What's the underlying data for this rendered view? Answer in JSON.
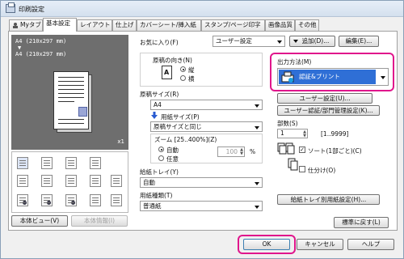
{
  "window": {
    "title": "印刷設定"
  },
  "tabs": [
    "Myタブ",
    "基本設定",
    "レイアウト",
    "仕上げ",
    "カバーシート/挿入紙",
    "スタンプ/ページ印字",
    "画像品質",
    "その他"
  ],
  "preview": {
    "size_line1": "A4 (210x297 mm)",
    "size_line2": "▼",
    "size_line3": "A4 (210x297 mm)",
    "copies_badge": "x1"
  },
  "left_buttons": {
    "preview_label": "本体ビュー(V)",
    "info_label": "本体情報(I)"
  },
  "favorites": {
    "label": "お気に入り(F)",
    "value": "ユーザー設定",
    "add_label": "追加(D)...",
    "edit_label": "編集(E)..."
  },
  "orientation": {
    "label": "原稿の向き(N)",
    "portrait": "縦",
    "landscape": "横"
  },
  "original_size": {
    "label": "原稿サイズ(R)",
    "value": "A4"
  },
  "paper_size": {
    "label": "用紙サイズ(P)",
    "value": "原稿サイズと同じ"
  },
  "zoom": {
    "label": "ズーム [25..400%](Z)",
    "auto": "自動",
    "custom": "任意",
    "value": "100",
    "unit": "%"
  },
  "paper_tray": {
    "label": "給紙トレイ(Y)",
    "value": "自動"
  },
  "paper_type": {
    "label": "用紙種類(T)",
    "value": "普通紙"
  },
  "output": {
    "label": "出力方法(M)",
    "value": "認証&プリント",
    "user_settings_label": "ユーザー設定(U)...",
    "auth_settings_label": "ユーザー認証/部門管理設定(K)..."
  },
  "copies": {
    "label": "部数(S)",
    "value": "1",
    "range": "[1..9999]",
    "collate_label": "ソート(1部ごと)(C)",
    "collate_checked": true,
    "offset_label": "仕分け(O)",
    "offset_checked": false
  },
  "tray_settings_label": "給紙トレイ別用紙設定(H)...",
  "restore_defaults_label": "標準に戻す(L)",
  "footer": {
    "ok": "OK",
    "cancel": "キャンセル",
    "help": "ヘルプ"
  },
  "colors": {
    "highlight": "#e0168c",
    "selected_bg": "#2f6fd6"
  }
}
